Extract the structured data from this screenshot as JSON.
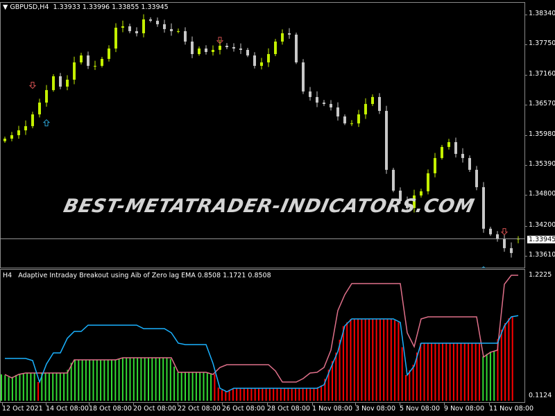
{
  "main_header": {
    "symbol": "GBPUSD,H4",
    "ohlc": "1.33933 1.33996 1.33855 1.33945"
  },
  "indicator_header": {
    "timeframe": "H4",
    "title": "Adaptive Intraday Breakout using Aib of Zero lag EMA 0.8508 1.1721 0.8508"
  },
  "watermark": "BEST-METATRADER-INDICATORS.COM",
  "current_price": "1.33945",
  "colors": {
    "bull": "#c4f000",
    "bear": "#c8c8c8",
    "hist_up": "#33dd33",
    "hist_down": "#ff0000",
    "line_fast": "#1ab2ff",
    "line_slow": "#e0708a",
    "arrow_down": "#d05050",
    "arrow_up": "#2aa0d0"
  },
  "chart_data": [
    {
      "type": "candlestick",
      "ylim": [
        1.33392,
        1.38625
      ],
      "price_ticks": [
        "1.38340",
        "1.37750",
        "1.37160",
        "1.36570",
        "1.35980",
        "1.35390",
        "1.34800",
        "1.34200",
        "1.33610"
      ],
      "closes": [
        1.35907,
        1.35975,
        1.3607,
        1.36152,
        1.36383,
        1.36614,
        1.36859,
        1.3713,
        1.36927,
        1.37063,
        1.37402,
        1.37538,
        1.37334,
        1.37334,
        1.3747,
        1.37674,
        1.38082,
        1.38109,
        1.38014,
        1.37973,
        1.38245,
        1.38218,
        1.3815,
        1.38055,
        1.38014,
        1.38014,
        1.3781,
        1.37565,
        1.37674,
        1.37606,
        1.37647,
        1.37728,
        1.37701,
        1.37674,
        1.37647,
        1.37538,
        1.37334,
        1.37402,
        1.37565,
        1.3781,
        1.37973,
        1.37946,
        1.37402,
        1.36832,
        1.36723,
        1.36614,
        1.36587,
        1.36519,
        1.36342,
        1.36206,
        1.36206,
        1.36383,
        1.36587,
        1.36723,
        1.36451,
        1.35296,
        1.34888,
        1.34684,
        1.34548,
        1.34793,
        1.34875,
        1.35228,
        1.35527,
        1.35744,
        1.35839,
        1.35608,
        1.35527,
        1.35296,
        1.34956,
        1.34141,
        1.34032,
        1.33937,
        1.3376,
        1.33665,
        1.33945
      ],
      "last_bar": {
        "open": 1.33933,
        "high": 1.33996,
        "low": 1.33855,
        "close": 1.33945
      },
      "signals": [
        {
          "bar": 4,
          "direction": "down",
          "price": 1.3696
        },
        {
          "bar": 6,
          "direction": "up",
          "price": 1.3621
        },
        {
          "bar": 31,
          "direction": "down",
          "price": 1.3784
        },
        {
          "bar": 69,
          "direction": "up",
          "price": 1.3333
        },
        {
          "bar": 72,
          "direction": "down",
          "price": 1.3409
        }
      ]
    },
    {
      "type": "line+histogram",
      "ylim": [
        0.0551,
        1.2799
      ],
      "axis_ticks": [
        "1.2225",
        "0.1124"
      ],
      "fast_line": [
        0.457,
        0.457,
        0.457,
        0.457,
        0.4379,
        0.2401,
        0.406,
        0.5081,
        0.5081,
        0.642,
        0.7058,
        0.7058,
        0.7632,
        0.7632,
        0.7632,
        0.7632,
        0.7632,
        0.7632,
        0.7632,
        0.7632,
        0.7313,
        0.7313,
        0.7313,
        0.7313,
        0.693,
        0.5974,
        0.5846,
        0.5846,
        0.5846,
        0.5846,
        0.4124,
        0.1827,
        0.1508,
        0.1827,
        0.1827,
        0.1827,
        0.1827,
        0.1827,
        0.1827,
        0.1827,
        0.1827,
        0.1827,
        0.1827,
        0.1827,
        0.1827,
        0.1827,
        0.2146,
        0.3741,
        0.5208,
        0.7568,
        0.8206,
        0.8206,
        0.8206,
        0.8206,
        0.8206,
        0.8206,
        0.8206,
        0.7887,
        0.3039,
        0.3869,
        0.5974,
        0.5974,
        0.5974,
        0.5974,
        0.5974,
        0.5974,
        0.5974,
        0.5974,
        0.5974,
        0.5974,
        0.5974,
        0.5974,
        0.7568,
        0.8398,
        0.8508
      ],
      "slow_line": [
        0.3103,
        0.2784,
        0.3103,
        0.3231,
        0.3231,
        0.3231,
        0.3231,
        0.3231,
        0.3231,
        0.3231,
        0.4443,
        0.4443,
        0.4443,
        0.4443,
        0.4443,
        0.4443,
        0.4443,
        0.4634,
        0.4634,
        0.4634,
        0.4634,
        0.4634,
        0.4634,
        0.4634,
        0.4634,
        0.3294,
        0.3294,
        0.3294,
        0.3294,
        0.3294,
        0.3103,
        0.3741,
        0.3996,
        0.3996,
        0.3996,
        0.3996,
        0.3996,
        0.3996,
        0.3996,
        0.3422,
        0.2401,
        0.2401,
        0.2401,
        0.272,
        0.3231,
        0.3294,
        0.3741,
        0.5336,
        0.8972,
        1.0439,
        1.146,
        1.146,
        1.146,
        1.146,
        1.146,
        1.146,
        1.146,
        1.146,
        0.693,
        0.5655,
        0.8206,
        0.8398,
        0.8398,
        0.8398,
        0.8398,
        0.8398,
        0.8398,
        0.8398,
        0.8398,
        0.4698,
        0.5144,
        0.5336,
        1.1396,
        1.2225,
        1.2225
      ]
    }
  ],
  "time_axis": [
    "12 Oct 2021",
    "14 Oct 08:00",
    "18 Oct 08:00",
    "20 Oct 08:00",
    "22 Oct 08:00",
    "26 Oct 08:00",
    "28 Oct 08:00",
    "1 Nov 08:00",
    "3 Nov 08:00",
    "5 Nov 08:00",
    "9 Nov 08:00",
    "11 Nov 08:00"
  ]
}
